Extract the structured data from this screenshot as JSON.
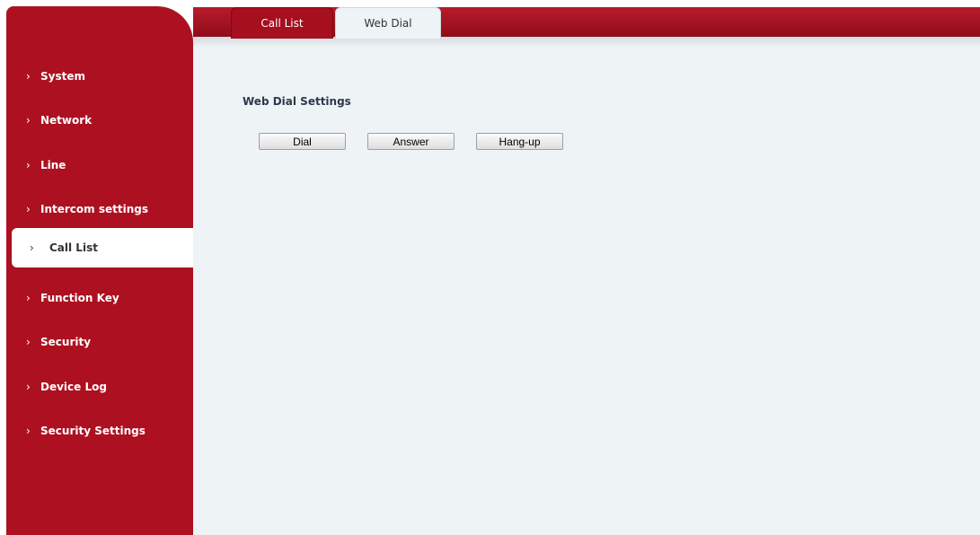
{
  "tabs": [
    {
      "label": "Call List",
      "active": true
    },
    {
      "label": "Web Dial",
      "active": false
    }
  ],
  "sidebar": {
    "items": [
      {
        "label": "System"
      },
      {
        "label": "Network"
      },
      {
        "label": "Line"
      },
      {
        "label": "Intercom settings"
      },
      {
        "label": "Call List",
        "active": true
      },
      {
        "label": "Function Key"
      },
      {
        "label": "Security"
      },
      {
        "label": "Device Log"
      },
      {
        "label": "Security Settings"
      }
    ],
    "chevron": "›"
  },
  "main": {
    "section_title": "Web Dial Settings",
    "buttons": {
      "dial": "Dial",
      "answer": "Answer",
      "hangup": "Hang-up"
    }
  },
  "colors": {
    "brand_red": "#ad1121",
    "content_bg": "#eef3f6"
  }
}
